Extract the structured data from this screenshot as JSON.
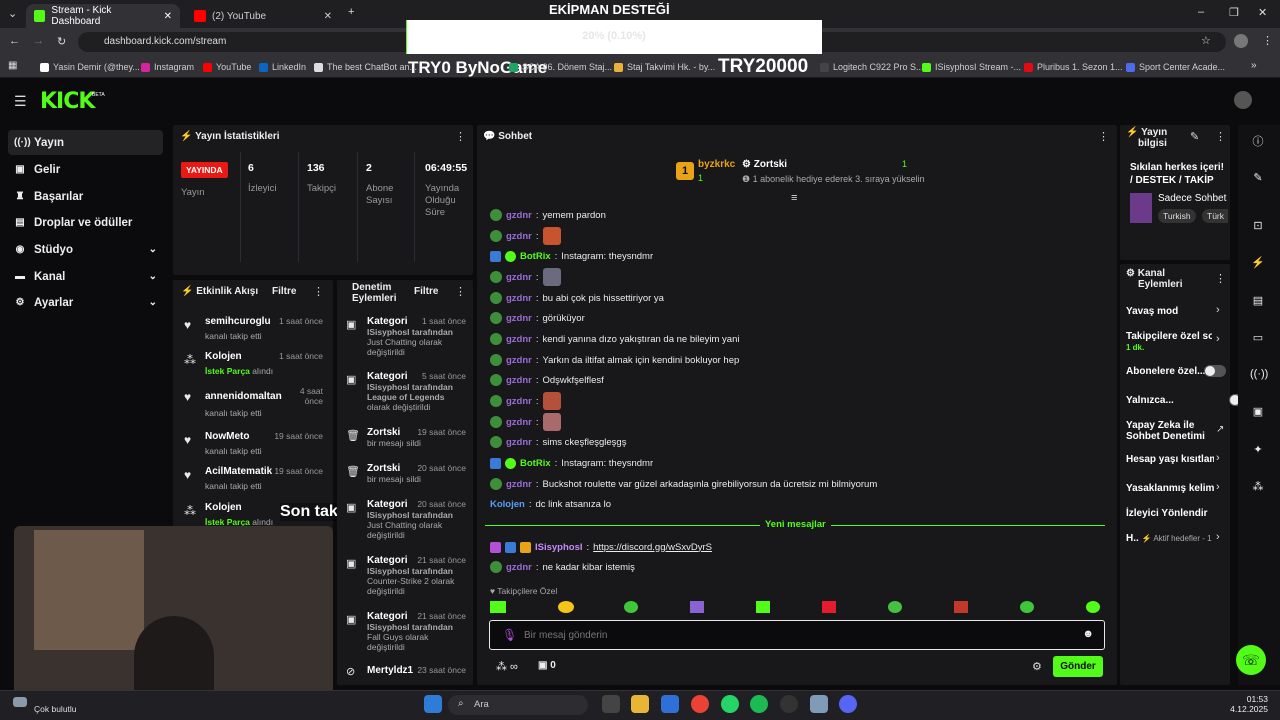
{
  "browser": {
    "tabs": [
      {
        "label": "Stream - Kick Dashboard"
      },
      {
        "label": "(2) YouTube"
      }
    ],
    "url": "dashboard.kick.com/stream",
    "bookmarks": [
      "Yasin Demir (@they...",
      "Instagram",
      "YouTube",
      "LinkedIn",
      "The best ChatBot an...",
      "TRY0 ByNoGame",
      "SCA 96. Dönem Staj...",
      "Staj Takvimi Hk. - by...",
      "TRY20000",
      "Logitech C922 Pro S...",
      "ISisyphosI Stream -...",
      "Pluribus 1. Sezon 1...",
      "Sport Center Acade..."
    ]
  },
  "overlay": {
    "title": "EKİPMAN DESTEĞİ",
    "goal": "20% (0.10%)",
    "caption": "Son tak"
  },
  "brand": {
    "logo": "KICK",
    "beta": "BETA"
  },
  "nav": [
    {
      "label": "Yayın",
      "icon": "broadcast-icon"
    },
    {
      "label": "Gelir",
      "icon": "revenue-icon"
    },
    {
      "label": "Başarılar",
      "icon": "trophy-icon"
    },
    {
      "label": "Droplar ve ödüller",
      "icon": "gift-icon"
    },
    {
      "label": "Stüdyo",
      "icon": "studio-icon"
    },
    {
      "label": "Kanal",
      "icon": "channel-icon"
    },
    {
      "label": "Ayarlar",
      "icon": "settings-icon"
    }
  ],
  "stats": {
    "title": "Yayın İstatistikleri",
    "live": "YAYINDA",
    "live_label": "Yayın",
    "viewers": "6",
    "viewers_label": "İzleyici",
    "followers": "136",
    "followers_label": "Takipçi",
    "subs": "2",
    "subs_label1": "Abone",
    "subs_label2": "Sayısı",
    "uptime": "06:49:55",
    "uptime_label1": "Yayında",
    "uptime_label2": "Olduğu",
    "uptime_label3": "Süre"
  },
  "activity": {
    "title": "Etkinlik Akışı",
    "filter": "Filtre",
    "items": [
      {
        "name": "semihcuroglu",
        "desc": "kanalı takip etti",
        "time": "1 saat önce"
      },
      {
        "name": "Kolojen",
        "desc": "İstek Parça alındı",
        "time": "1 saat önce"
      },
      {
        "name": "annenidomaltan",
        "desc": "kanalı takip etti",
        "time1": "4 saat",
        "time2": "önce"
      },
      {
        "name": "NowMeto",
        "desc": "kanalı takip etti",
        "time": "19 saat önce"
      },
      {
        "name": "AcilMatematik",
        "desc": "kanalı takip etti",
        "time": "19 saat önce"
      },
      {
        "name": "Kolojen",
        "desc": "İstek Parça alındı",
        "time": "19 saat önce"
      }
    ]
  },
  "moderation": {
    "title1": "Denetim",
    "title2": "Eylemleri",
    "filter": "Filtre",
    "items": [
      {
        "name": "Kategori",
        "time": "1 saat önce",
        "l1": "ISisyphosI tarafından",
        "l2": "Just Chatting olarak",
        "l3": "değiştirildi"
      },
      {
        "name": "Kategori",
        "time": "5 saat önce",
        "l1": "ISisyphosI tarafından",
        "l2": "League of Legends",
        "l3": "olarak değiştirildi"
      },
      {
        "name": "Zortski",
        "time": "19 saat önce",
        "l1": "bir mesajı sildi"
      },
      {
        "name": "Zortski",
        "time": "20 saat önce",
        "l1": "bir mesajı sildi"
      },
      {
        "name": "Kategori",
        "time": "20 saat önce",
        "l1": "ISisyphosI tarafından",
        "l2": "Just Chatting olarak",
        "l3": "değiştirildi"
      },
      {
        "name": "Kategori",
        "time": "21 saat önce",
        "l1": "ISisyphosI tarafından",
        "l2": "Counter-Strike 2 olarak",
        "l3": "değiştirildi"
      },
      {
        "name": "Kategori",
        "time": "21 saat önce",
        "l1": "ISisyphosI tarafından",
        "l2": "Fall Guys olarak",
        "l3": "değiştirildi"
      },
      {
        "name": "Mertyldz1",
        "time": "23 saat önce"
      }
    ]
  },
  "chat": {
    "title": "Sohbet",
    "pinned": {
      "user1": "byzkrkc",
      "count1": "1",
      "user2": "Zortski",
      "count2": "1",
      "text": "1 abonelik hediye ederek 3. sıraya yükselin"
    },
    "messages": [
      {
        "user": "gzdnr",
        "text": "yemem pardon"
      },
      {
        "user": "gzdnr",
        "text": "",
        "emote": "#c7542f"
      },
      {
        "user": "BotRix",
        "text": "Instagram: theysndmr",
        "bot": true
      },
      {
        "user": "gzdnr",
        "text": "",
        "emote": "#6b6b80"
      },
      {
        "user": "gzdnr",
        "text": "bu abi çok pis hissettiriyor ya"
      },
      {
        "user": "gzdnr",
        "text": "görüküyor"
      },
      {
        "user": "gzdnr",
        "text": "kendi yanına dızo yakıştıran da ne bileyim yani"
      },
      {
        "user": "gzdnr",
        "text": "Yarkın da iltifat almak için kendini bokluyor hep"
      },
      {
        "user": "gzdnr",
        "text": "Odşwkfşelflesf"
      },
      {
        "user": "gzdnr",
        "text": "",
        "emote": "#b5503a"
      },
      {
        "user": "gzdnr",
        "text": "",
        "emote": "#a86a6a"
      },
      {
        "user": "gzdnr",
        "text": "sims ckeşfleşgleşgş"
      },
      {
        "user": "BotRix",
        "text": "Instagram: theysndmr",
        "bot": true
      },
      {
        "user": "gzdnr",
        "text": "Buckshot roulette var güzel arkadaşınla girebiliyorsun da ücretsiz mi bilmiyorum"
      },
      {
        "user": "Kolojen",
        "text": "dc link atsanıza lo",
        "plain": true
      }
    ],
    "new_label": "Yeni mesajlar",
    "after": [
      {
        "user": "ISisyphosI",
        "text": "https://discord.gg/wSxvDyrS",
        "owner": true
      },
      {
        "user": "gzdnr",
        "text": "ne kadar kibar istemiş"
      }
    ],
    "followers_only": "Takipçilere Özel",
    "placeholder": "Bir mesaj gönderin",
    "points": "0",
    "send": "Gönder"
  },
  "streaminfo": {
    "title1": "Yayın",
    "title2": "bilgisi",
    "stream_title": "Sıkılan herkes içeri! / DESTEK / TAKİP",
    "category": "Sadece Sohbet",
    "tags": [
      "Turkish",
      "Türk"
    ]
  },
  "channel_actions": {
    "title1": "Kanal",
    "title2": "Eylemleri",
    "slow": "Yavaş mod",
    "followers_only": "Takipçilere özel soh",
    "followers_time": "1 dk.",
    "subs_only": "Abonelere özel...",
    "emotes_only": "Yalnızca...",
    "ai1": "Yapay Zeka ile",
    "ai2": "Sohbet Denetimi",
    "age": "Hesap yaşı kısıtlam",
    "banned": "Yasaklanmış kelime",
    "raid": "İzleyici Yönlendir",
    "goals": "H..",
    "goals_sub": "Aktif hedefler - 1"
  },
  "taskbar": {
    "weather": "Çok bulutlu",
    "search": "Ara",
    "time": "01:53",
    "date": "4.12.2025"
  },
  "colors": {
    "accent": "#53fc18",
    "live": "#e91916",
    "panel": "#18181b"
  }
}
